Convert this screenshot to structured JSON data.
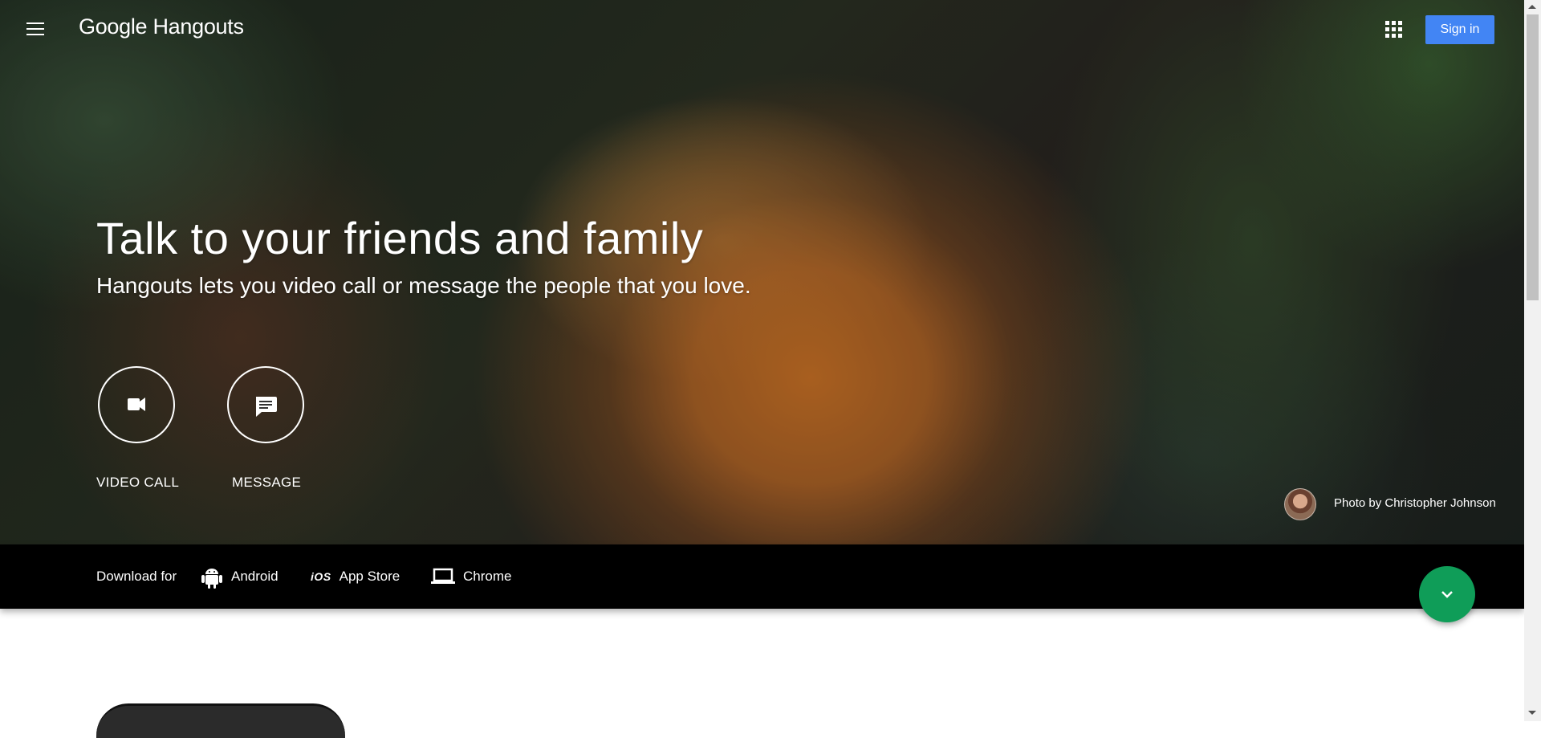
{
  "header": {
    "logo_google": "Google",
    "logo_product": "Hangouts",
    "sign_in_label": "Sign in",
    "icons": {
      "menu": "hamburger-menu-icon",
      "apps": "apps-grid-icon"
    }
  },
  "hero": {
    "headline": "Talk to your friends and family",
    "subhead": "Hangouts lets you video call or message the people that you love.",
    "actions": [
      {
        "label": "VIDEO CALL",
        "icon": "videocam-icon"
      },
      {
        "label": "MESSAGE",
        "icon": "chat-message-icon"
      }
    ],
    "photo_credit": "Photo by Christopher Johnson"
  },
  "download": {
    "label": "Download for",
    "items": [
      {
        "label": "Android",
        "icon": "android-icon"
      },
      {
        "label": "App Store",
        "icon": "ios-icon"
      },
      {
        "label": "Chrome",
        "icon": "laptop-icon"
      }
    ]
  },
  "fab": {
    "icon": "chevron-down-icon"
  },
  "colors": {
    "sign_in": "#4285f4",
    "fab": "#0f9d58",
    "download_bar": "#000000"
  }
}
